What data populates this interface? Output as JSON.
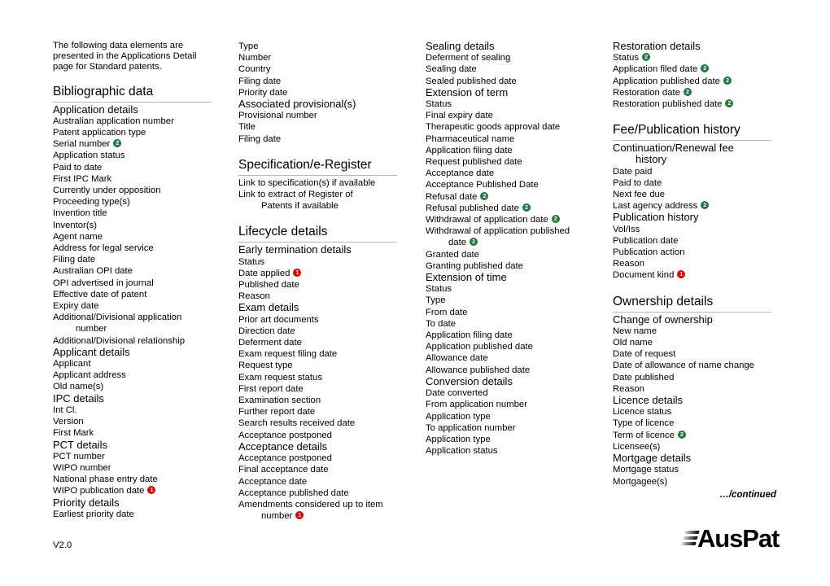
{
  "document": {
    "intro": "The following data elements are presented in the Applications Detail page for Standard patents.",
    "version": "V2.0",
    "continued": "…/continued",
    "logo_text": "AusPat"
  },
  "columns": [
    {
      "blocks": [
        {
          "type": "section",
          "text": "Bibliographic data"
        },
        {
          "type": "sub",
          "text": "Application details"
        },
        {
          "type": "item",
          "text": "Australian application number"
        },
        {
          "type": "item",
          "text": "Patent application type"
        },
        {
          "type": "item",
          "text": "Serial number",
          "marker": "green"
        },
        {
          "type": "item",
          "text": "Application status"
        },
        {
          "type": "item",
          "text": "Paid to date"
        },
        {
          "type": "item",
          "text": "First IPC Mark"
        },
        {
          "type": "item",
          "text": "Currently under opposition"
        },
        {
          "type": "item",
          "text": "Proceeding type(s)"
        },
        {
          "type": "item",
          "text": "Invention title"
        },
        {
          "type": "item",
          "text": "Inventor(s)"
        },
        {
          "type": "item",
          "text": "Agent name"
        },
        {
          "type": "item",
          "text": "Address for legal service"
        },
        {
          "type": "item",
          "text": "Filing date"
        },
        {
          "type": "item",
          "text": "Australian OPI date"
        },
        {
          "type": "item",
          "text": "OPI advertised in journal"
        },
        {
          "type": "item",
          "text": "Effective date of patent"
        },
        {
          "type": "item",
          "text": "Expiry date"
        },
        {
          "type": "item",
          "text": "Additional/Divisional application",
          "cont": "number"
        },
        {
          "type": "item",
          "text": "Additional/Divisional relationship"
        },
        {
          "type": "sub",
          "text": "Applicant details"
        },
        {
          "type": "item",
          "text": "Applicant"
        },
        {
          "type": "item",
          "text": "Applicant address"
        },
        {
          "type": "item",
          "text": "Old name(s)"
        },
        {
          "type": "sub",
          "text": "IPC details"
        },
        {
          "type": "item",
          "text": "Int Cl."
        },
        {
          "type": "item",
          "text": "Version"
        },
        {
          "type": "item",
          "text": "First Mark"
        },
        {
          "type": "sub",
          "text": "PCT details"
        },
        {
          "type": "item",
          "text": "PCT number"
        },
        {
          "type": "item",
          "text": "WIPO number"
        },
        {
          "type": "item",
          "text": "National phase entry date"
        },
        {
          "type": "item",
          "text": "WIPO publication date",
          "marker": "red"
        },
        {
          "type": "sub",
          "text": "Priority details"
        },
        {
          "type": "item",
          "text": "Earliest priority date"
        }
      ]
    },
    {
      "blocks": [
        {
          "type": "item",
          "text": "Type"
        },
        {
          "type": "item",
          "text": "Number"
        },
        {
          "type": "item",
          "text": "Country"
        },
        {
          "type": "item",
          "text": "Filing date"
        },
        {
          "type": "item",
          "text": "Priority date"
        },
        {
          "type": "sub",
          "text": "Associated provisional(s)"
        },
        {
          "type": "item",
          "text": "Provisional number"
        },
        {
          "type": "item",
          "text": "Title"
        },
        {
          "type": "item",
          "text": "Filing date"
        },
        {
          "type": "section",
          "text": "Specification/e-Register",
          "pad_top": true
        },
        {
          "type": "item",
          "text": "Link to specification(s) if available"
        },
        {
          "type": "item",
          "text": "Link to extract of Register of",
          "cont": "Patents if available"
        },
        {
          "type": "section",
          "text": "Lifecycle details",
          "pad_top": true
        },
        {
          "type": "sub",
          "text": "Early termination details"
        },
        {
          "type": "item",
          "text": "Status"
        },
        {
          "type": "item",
          "text": "Date applied",
          "marker": "red"
        },
        {
          "type": "item",
          "text": "Published date"
        },
        {
          "type": "item",
          "text": "Reason"
        },
        {
          "type": "sub",
          "text": "Exam details"
        },
        {
          "type": "item",
          "text": "Prior art documents"
        },
        {
          "type": "item",
          "text": "Direction date"
        },
        {
          "type": "item",
          "text": "Deferment date"
        },
        {
          "type": "item",
          "text": "Exam request filing date"
        },
        {
          "type": "item",
          "text": "Request type"
        },
        {
          "type": "item",
          "text": "Exam request status"
        },
        {
          "type": "item",
          "text": "First report date"
        },
        {
          "type": "item",
          "text": "Examination section"
        },
        {
          "type": "item",
          "text": "Further report date"
        },
        {
          "type": "item",
          "text": "Search results received date"
        },
        {
          "type": "item",
          "text": "Acceptance postponed"
        },
        {
          "type": "sub",
          "text": "Acceptance details"
        },
        {
          "type": "item",
          "text": "Acceptance postponed"
        },
        {
          "type": "item",
          "text": "Final acceptance date"
        },
        {
          "type": "item",
          "text": "Acceptance date"
        },
        {
          "type": "item",
          "text": "Acceptance published date"
        },
        {
          "type": "item",
          "text": "Amendments considered up to item",
          "cont": "number",
          "cont_marker": "red"
        }
      ]
    },
    {
      "blocks": [
        {
          "type": "sub",
          "text": "Sealing details"
        },
        {
          "type": "item",
          "text": "Deferment of sealing"
        },
        {
          "type": "item",
          "text": "Sealing date"
        },
        {
          "type": "item",
          "text": "Sealed published date"
        },
        {
          "type": "sub",
          "text": "Extension of term"
        },
        {
          "type": "item",
          "text": "Status"
        },
        {
          "type": "item",
          "text": "Final expiry date"
        },
        {
          "type": "item",
          "text": "Therapeutic goods approval date"
        },
        {
          "type": "item",
          "text": "Pharmaceutical name"
        },
        {
          "type": "item",
          "text": "Application filing date"
        },
        {
          "type": "item",
          "text": "Request published date"
        },
        {
          "type": "item",
          "text": "Acceptance date"
        },
        {
          "type": "item",
          "text": "Acceptance Published Date"
        },
        {
          "type": "item",
          "text": "Refusal date",
          "marker": "green"
        },
        {
          "type": "item",
          "text": "Refusal published date",
          "marker": "green"
        },
        {
          "type": "item",
          "text": "Withdrawal of application date",
          "marker": "green"
        },
        {
          "type": "item",
          "text": "Withdrawal of application published",
          "cont": "date",
          "cont_marker": "green"
        },
        {
          "type": "item",
          "text": "Granted date"
        },
        {
          "type": "item",
          "text": "Granting published date"
        },
        {
          "type": "sub",
          "text": "Extension of time"
        },
        {
          "type": "item",
          "text": "Status"
        },
        {
          "type": "item",
          "text": "Type"
        },
        {
          "type": "item",
          "text": "From date"
        },
        {
          "type": "item",
          "text": "To date"
        },
        {
          "type": "item",
          "text": "Application filing date"
        },
        {
          "type": "item",
          "text": "Application published date"
        },
        {
          "type": "item",
          "text": "Allowance date"
        },
        {
          "type": "item",
          "text": "Allowance published date"
        },
        {
          "type": "sub",
          "text": "Conversion details"
        },
        {
          "type": "item",
          "text": "Date converted"
        },
        {
          "type": "item",
          "text": "From application number"
        },
        {
          "type": "item",
          "text": "Application type"
        },
        {
          "type": "item",
          "text": "To application number"
        },
        {
          "type": "item",
          "text": "Application type"
        },
        {
          "type": "item",
          "text": "Application status"
        }
      ]
    },
    {
      "blocks": [
        {
          "type": "sub",
          "text": "Restoration details"
        },
        {
          "type": "item",
          "text": "Status",
          "marker": "green"
        },
        {
          "type": "item",
          "text": "Application filed date",
          "marker": "green"
        },
        {
          "type": "item",
          "text": "Application published date",
          "marker": "green"
        },
        {
          "type": "item",
          "text": "Restoration date",
          "marker": "green"
        },
        {
          "type": "item",
          "text": "Restoration published date",
          "marker": "green"
        },
        {
          "type": "section",
          "text": "Fee/Publication history",
          "pad_top": true
        },
        {
          "type": "sub",
          "text": "Continuation/Renewal fee",
          "cont": "history"
        },
        {
          "type": "item",
          "text": "Date paid"
        },
        {
          "type": "item",
          "text": "Paid to date"
        },
        {
          "type": "item",
          "text": "Next fee due"
        },
        {
          "type": "item",
          "text": "Last agency address",
          "marker": "green"
        },
        {
          "type": "sub",
          "text": "Publication history"
        },
        {
          "type": "item",
          "text": "Vol/Iss"
        },
        {
          "type": "item",
          "text": "Publication date"
        },
        {
          "type": "item",
          "text": "Publication action"
        },
        {
          "type": "item",
          "text": "Reason"
        },
        {
          "type": "item",
          "text": "Document kind",
          "marker": "red"
        },
        {
          "type": "section",
          "text": "Ownership details",
          "pad_top": true
        },
        {
          "type": "sub",
          "text": "Change of ownership"
        },
        {
          "type": "item",
          "text": "New name"
        },
        {
          "type": "item",
          "text": "Old name"
        },
        {
          "type": "item",
          "text": "Date of request"
        },
        {
          "type": "item",
          "text": "Date of allowance of name change"
        },
        {
          "type": "item",
          "text": "Date published"
        },
        {
          "type": "item",
          "text": "Reason"
        },
        {
          "type": "sub",
          "text": "Licence details"
        },
        {
          "type": "item",
          "text": "Licence status"
        },
        {
          "type": "item",
          "text": "Type of licence"
        },
        {
          "type": "item",
          "text": "Term of licence",
          "marker": "green"
        },
        {
          "type": "item",
          "text": "Licensee(s)"
        },
        {
          "type": "sub",
          "text": "Mortgage details"
        },
        {
          "type": "item",
          "text": "Mortgage status"
        },
        {
          "type": "item",
          "text": "Mortgagee(s)"
        }
      ]
    }
  ],
  "markers": {
    "green_label": "2",
    "red_label": "1",
    "green_color": "#1a7a3c",
    "red_color": "#e00000"
  }
}
